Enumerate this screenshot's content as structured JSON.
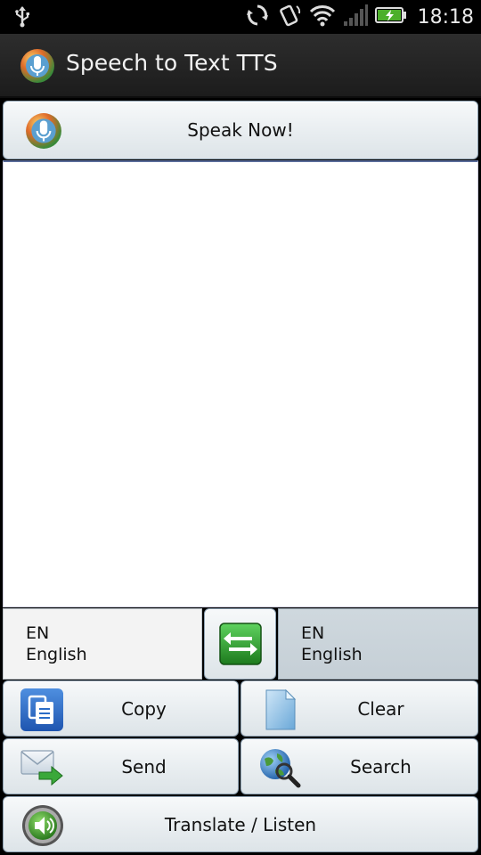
{
  "status_bar": {
    "time": "18:18",
    "icons": [
      "usb-icon",
      "sync-icon",
      "rotate-icon",
      "wifi-icon",
      "signal-icon",
      "battery-charging-icon"
    ]
  },
  "title_bar": {
    "title": "Speech to Text TTS",
    "icon": "microphone-app-icon"
  },
  "speak": {
    "label": "Speak Now!",
    "icon": "microphone-icon"
  },
  "text_area": {
    "value": ""
  },
  "source_language": {
    "code": "EN",
    "name": "English"
  },
  "target_language": {
    "code": "EN",
    "name": "English"
  },
  "swap": {
    "icon": "swap-arrows-icon"
  },
  "actions": {
    "copy_label": "Copy",
    "clear_label": "Clear",
    "send_label": "Send",
    "search_label": "Search",
    "translate_label": "Translate / Listen"
  },
  "colors": {
    "title_bar_bg": "#1f1f1f",
    "button_border": "#8fa3b4",
    "swap_green": "#2e9e2e",
    "copy_blue": "#2a6cc7"
  }
}
